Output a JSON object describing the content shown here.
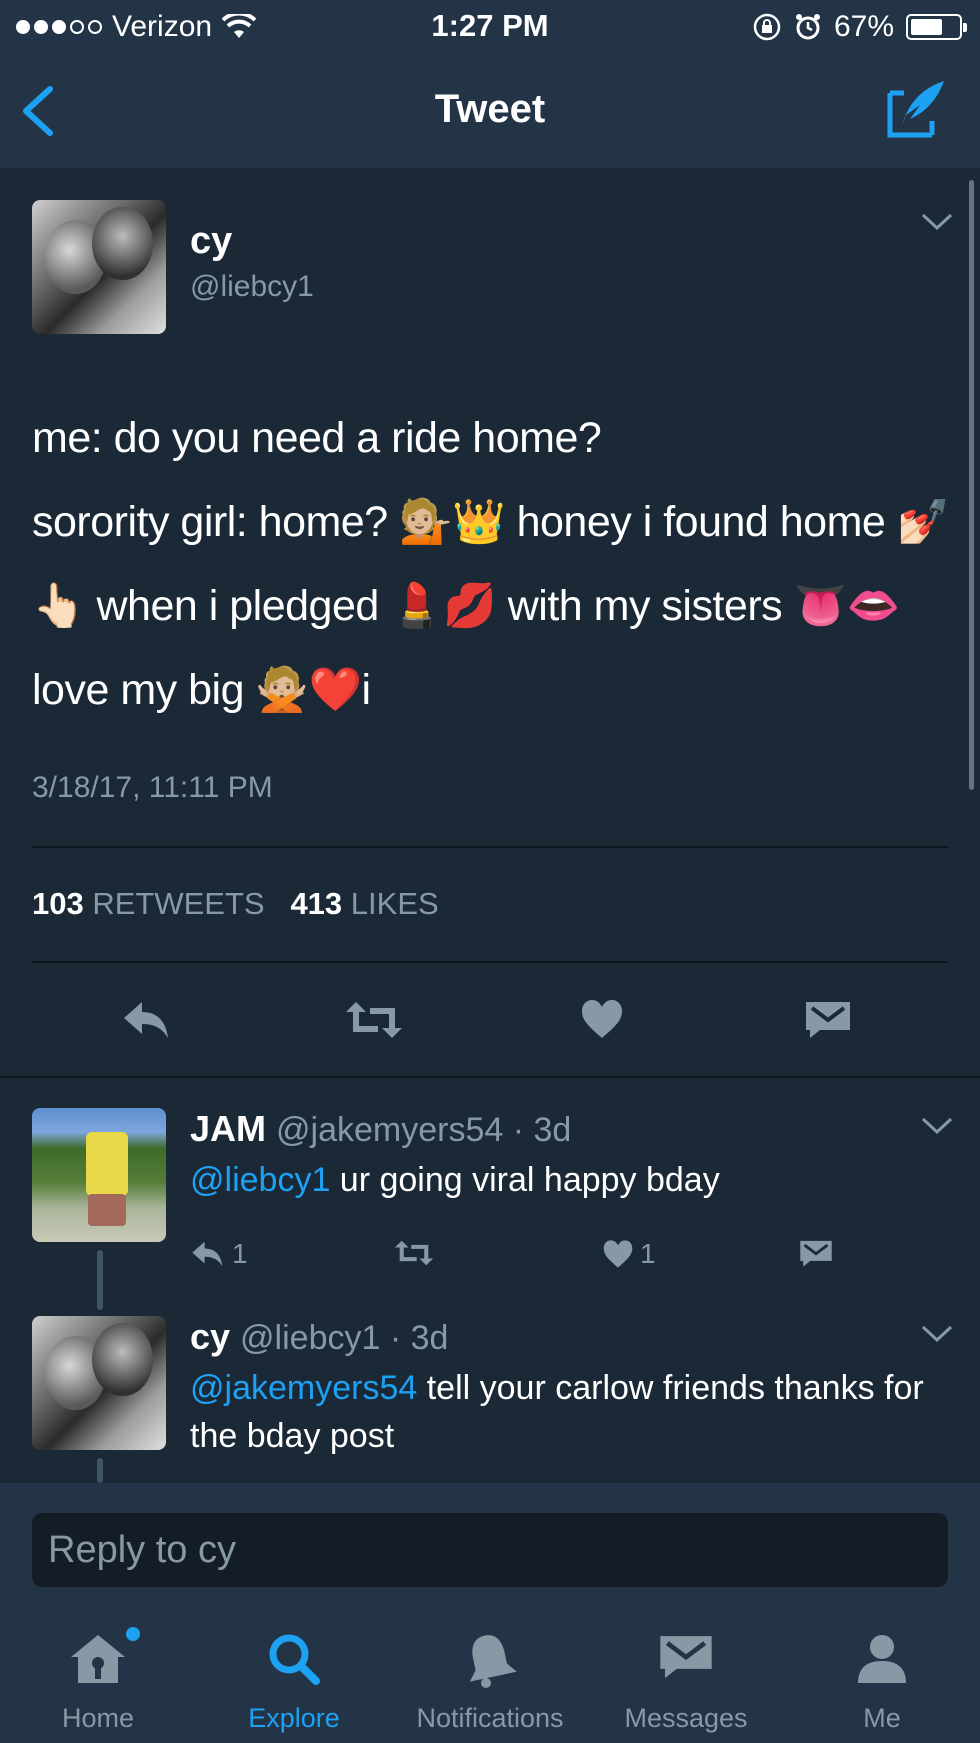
{
  "status_bar": {
    "carrier": "Verizon",
    "time": "1:27 PM",
    "battery": "67%",
    "battery_level": 0.67
  },
  "nav": {
    "title": "Tweet",
    "back_icon": "chevron-left-icon",
    "compose_icon": "compose-tweet-icon"
  },
  "tweet": {
    "author_name": "cy",
    "author_handle": "@liebcy1",
    "text_line1": "me: do you need a ride home?",
    "text_line2": "sorority girl: home? 💁🏼👑 honey i found home 💅🏻👆🏻 when i pledged 💄💋 with my sisters 👅👄love my big 🙅🏼❤️i",
    "timestamp": "3/18/17, 11:11 PM",
    "retweet_count": "103",
    "retweet_label": "RETWEETS",
    "like_count": "413",
    "like_label": "LIKES"
  },
  "replies": [
    {
      "name": "JAM",
      "handle": "@jakemyers54",
      "age": "· 3d",
      "mention": "@liebcy1",
      "text": " ur going viral happy bday",
      "reply_count": "1",
      "like_count": "1"
    },
    {
      "name": "cy",
      "handle": "@liebcy1",
      "age": "· 3d",
      "mention": "@jakemyers54",
      "text": " tell your carlow friends thanks for the bday post"
    }
  ],
  "composer": {
    "placeholder": "Reply to cy"
  },
  "tabs": [
    {
      "label": "Home",
      "icon": "home-icon"
    },
    {
      "label": "Explore",
      "icon": "search-icon"
    },
    {
      "label": "Notifications",
      "icon": "bell-icon"
    },
    {
      "label": "Messages",
      "icon": "envelope-icon"
    },
    {
      "label": "Me",
      "icon": "person-icon"
    }
  ],
  "colors": {
    "background": "#1b2836",
    "bar": "#243447",
    "accent": "#1da1f2",
    "secondary_text": "#8899a6"
  }
}
